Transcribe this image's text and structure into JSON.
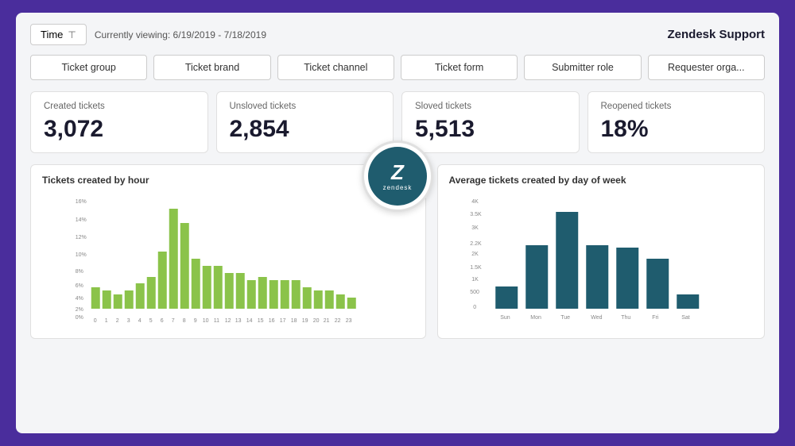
{
  "header": {
    "time_label": "Time",
    "viewing_text": "Currently viewing: 6/19/2019 - 7/18/2019",
    "brand": "Zendesk Support"
  },
  "segments": [
    {
      "label": "Ticket group"
    },
    {
      "label": "Ticket brand"
    },
    {
      "label": "Ticket channel"
    },
    {
      "label": "Ticket form"
    },
    {
      "label": "Submitter role"
    },
    {
      "label": "Requester orga..."
    }
  ],
  "stats": [
    {
      "label": "Created tickets",
      "value": "3,072"
    },
    {
      "label": "Unsloved tickets",
      "value": "2,854"
    },
    {
      "label": "Sloved tickets",
      "value": "5,513"
    },
    {
      "label": "Reopened tickets",
      "value": "18%"
    }
  ],
  "charts": {
    "left": {
      "title": "Tickets created by hour",
      "y_labels": [
        "16%",
        "14%",
        "12%",
        "10%",
        "8%",
        "6%",
        "4%",
        "2%",
        "0%"
      ],
      "x_labels": [
        "0",
        "1",
        "2",
        "3",
        "4",
        "5",
        "6",
        "7",
        "8",
        "9",
        "10",
        "11",
        "12",
        "13",
        "14",
        "15",
        "16",
        "17",
        "18",
        "19",
        "20",
        "21",
        "22",
        "23"
      ],
      "bars": [
        3,
        2.5,
        2,
        2.5,
        3.5,
        4.5,
        8,
        14,
        12,
        7,
        6,
        6,
        5,
        5,
        4,
        4.5,
        4,
        4,
        4,
        3,
        2.5,
        2.5,
        2,
        1.5
      ]
    },
    "right": {
      "title": "Average tickets created by day of week",
      "y_labels": [
        "4K",
        "3.5K",
        "3K",
        "2.2K",
        "2K",
        "1.5K",
        "1K",
        "500",
        "0"
      ],
      "x_labels": [
        "Sun",
        "Mon",
        "Tue",
        "Wed",
        "Thu",
        "Fri",
        "Sat"
      ],
      "bars": [
        0.8,
        2.3,
        3.5,
        2.3,
        2.2,
        1.8,
        0.5
      ]
    }
  },
  "zendesk_logo": {
    "letter": "Z",
    "name": "zendesk"
  }
}
